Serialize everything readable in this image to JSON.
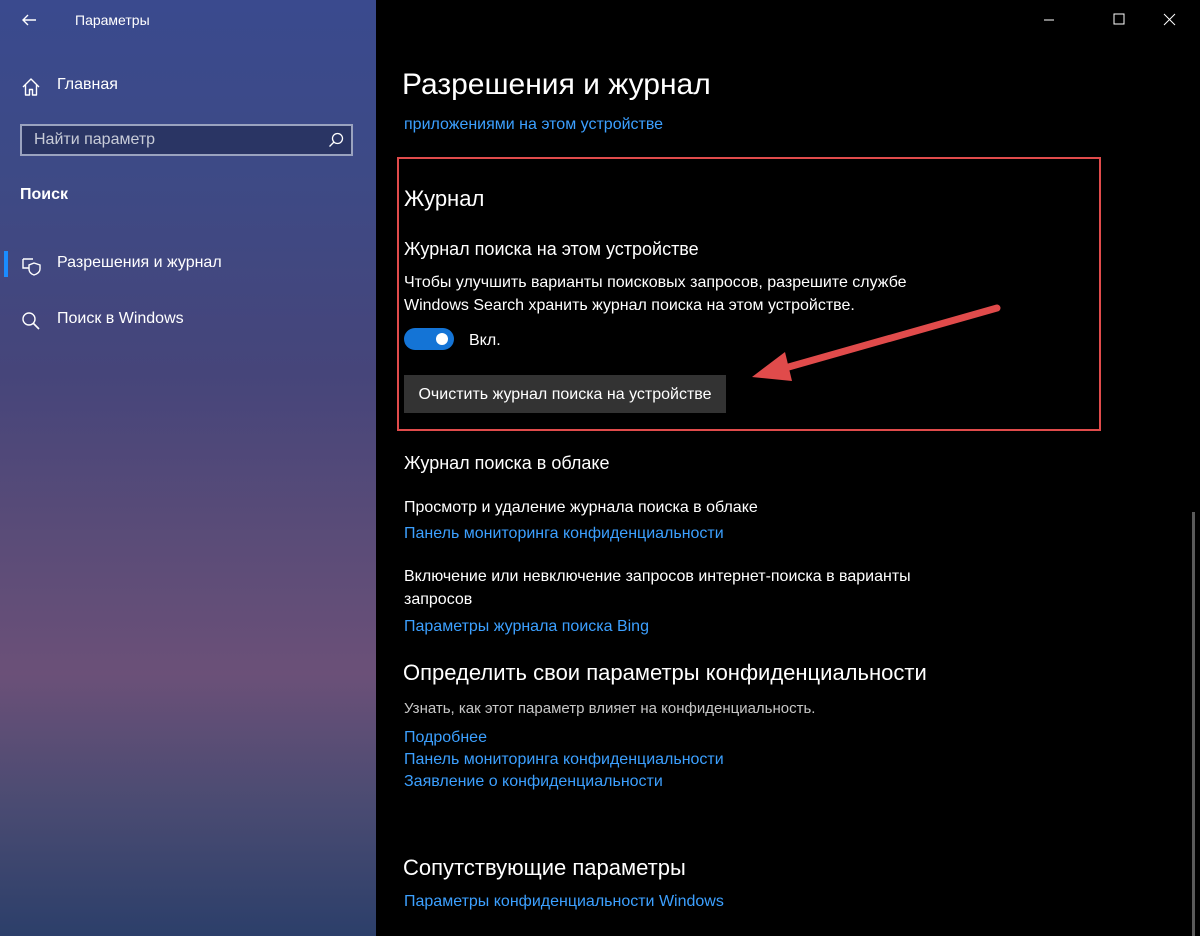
{
  "window": {
    "app_title": "Параметры",
    "controls": [
      "minimize",
      "maximize",
      "close"
    ]
  },
  "sidebar": {
    "home_label": "Главная",
    "search": {
      "placeholder": "Найти параметр",
      "value": ""
    },
    "section_label": "Поиск",
    "items": [
      {
        "label": "Разрешения и журнал",
        "icon": "shield-search-icon",
        "selected": true
      },
      {
        "label": "Поиск в Windows",
        "icon": "search-icon",
        "selected": false
      }
    ]
  },
  "content": {
    "title": "Разрешения и журнал",
    "top_link": "приложениями на этом устройстве",
    "history": {
      "heading": "Журнал",
      "subheading": "Журнал поиска на этом устройстве",
      "description_line1": "Чтобы улучшить варианты поисковых запросов, разрешите службе",
      "description_line2": "Windows Search хранить журнал поиска на этом устройстве.",
      "toggle_state": "Вкл.",
      "toggle_on": true,
      "clear_button": "Очистить журнал поиска на устройстве"
    },
    "cloud": {
      "heading": "Журнал поиска в облаке",
      "view_text": "Просмотр и удаление журнала поиска в облаке",
      "view_link": "Панель мониторинга конфиденциальности",
      "include_line1": "Включение или невключение запросов интернет-поиска в варианты",
      "include_line2": "запросов",
      "bing_link": "Параметры журнала поиска Bing"
    },
    "privacy": {
      "heading": "Определить свои параметры конфиденциальности",
      "desc": "Узнать, как этот параметр влияет на конфиденциальность.",
      "links": [
        "Подробнее",
        "Панель мониторинга конфиденциальности",
        "Заявление о конфиденциальности"
      ]
    },
    "related": {
      "heading": "Сопутствующие параметры",
      "link": "Параметры конфиденциальности Windows"
    }
  },
  "colors": {
    "accent": "#1474d6",
    "link": "#3ca0ff",
    "annotation": "#e04b4b"
  }
}
